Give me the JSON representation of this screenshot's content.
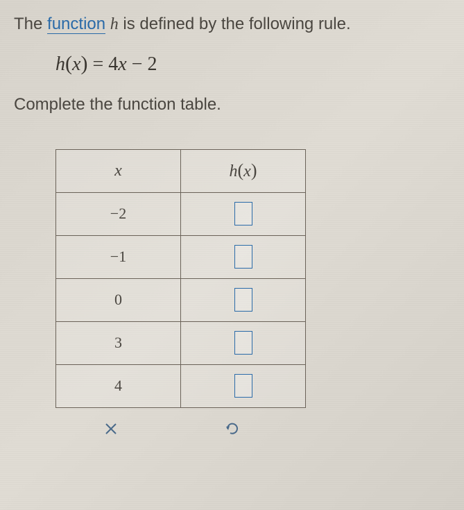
{
  "intro": {
    "prefix": "The ",
    "link_word": "function",
    "mid": " ",
    "var": "h",
    "suffix": " is defined by the following rule."
  },
  "equation": {
    "func": "h",
    "arg": "x",
    "eq": " = ",
    "coef": "4",
    "var2": "x",
    "op": " − ",
    "const": "2"
  },
  "instruction": "Complete the function table.",
  "table": {
    "headers": {
      "x": "x",
      "hx_func": "h",
      "hx_arg": "x"
    },
    "rows": [
      {
        "x": "−2"
      },
      {
        "x": "−1"
      },
      {
        "x": "0"
      },
      {
        "x": "3"
      },
      {
        "x": "4"
      }
    ]
  },
  "chart_data": {
    "type": "table",
    "title": "Function table for h(x) = 4x − 2",
    "columns": [
      "x",
      "h(x)"
    ],
    "rows": [
      {
        "x": -2,
        "h(x)": null
      },
      {
        "x": -1,
        "h(x)": null
      },
      {
        "x": 0,
        "h(x)": null
      },
      {
        "x": 3,
        "h(x)": null
      },
      {
        "x": 4,
        "h(x)": null
      }
    ]
  }
}
